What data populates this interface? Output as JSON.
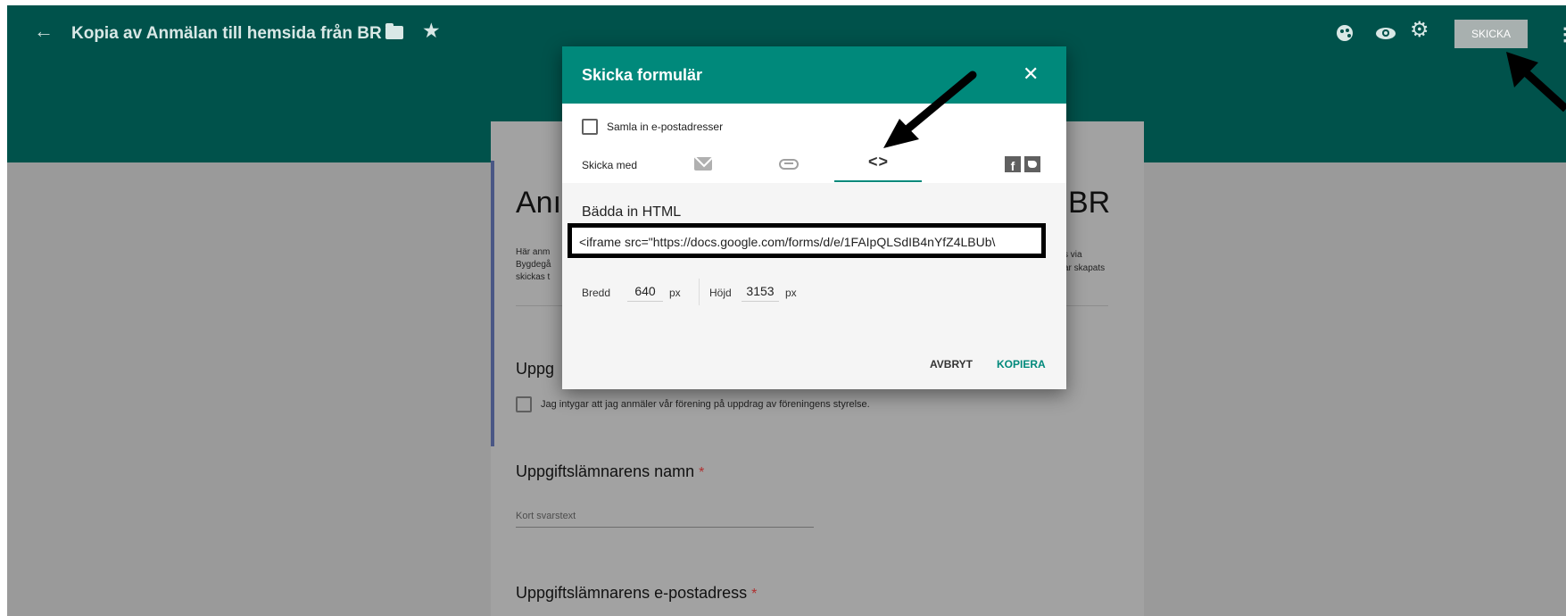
{
  "header": {
    "title": "Kopia av Anmälan till hemsida från BR",
    "send_label": "SKICKA",
    "back_glyph": "←",
    "star_glyph": "★",
    "gear_glyph": "⚙",
    "more_glyph": "⋮"
  },
  "form": {
    "title_left": "Anı",
    "title_right": "BR",
    "desc_left": [
      "Här anm",
      "Bygdegå",
      "skickas t"
    ],
    "desc_right": [
      "s via",
      "ar skapats"
    ],
    "section_title": "Uppg",
    "consent_label": "Jag intygar att jag anmäler vår förening på uppdrag av föreningens styrelse.",
    "q_name": "Uppgiftslämnarens namn",
    "q_email": "Uppgiftslämnarens e-postadress",
    "required_mark": "*",
    "short_answer_placeholder": "Kort svarstext"
  },
  "dialog": {
    "title": "Skicka formulär",
    "close_glyph": "✕",
    "collect_emails_label": "Samla in e-postadresser",
    "send_via_label": "Skicka med",
    "embed_glyph": "<>",
    "facebook_glyph": "f",
    "embed_title": "Bädda in HTML",
    "embed_code": "<iframe src=\"https://docs.google.com/forms/d/e/1FAIpQLSdIB4nYfZ4LBUb\\",
    "width_label": "Bredd",
    "width_value": "640",
    "height_label": "Höjd",
    "height_value": "3153",
    "unit": "px",
    "cancel_label": "AVBRYT",
    "copy_label": "KOPIERA"
  },
  "colors": {
    "header_bg": "#00524b",
    "dialog_header_bg": "#00897b",
    "accent": "#00897b",
    "overlay_bg": "#9a9a9a"
  },
  "icons": [
    "back-arrow-icon",
    "folder-icon",
    "star-icon",
    "palette-icon",
    "eye-icon",
    "gear-icon",
    "more-icon",
    "close-icon",
    "mail-icon",
    "link-icon",
    "embed-code-icon",
    "facebook-icon",
    "twitter-icon"
  ]
}
